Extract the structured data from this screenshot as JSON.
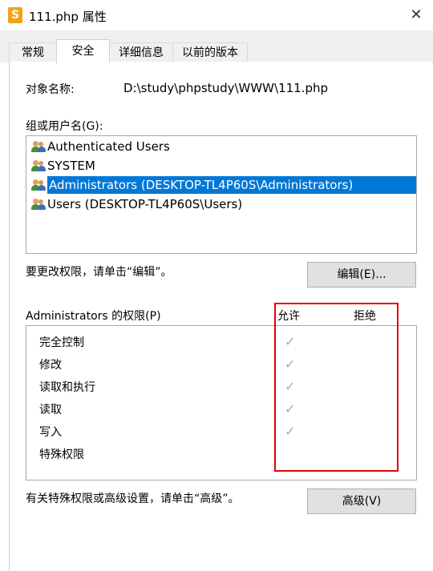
{
  "window": {
    "title": "111.php 属性",
    "app_icon": "sublime-text-icon",
    "close_label": "✕"
  },
  "tabs": [
    {
      "label": "常规",
      "active": false
    },
    {
      "label": "安全",
      "active": true
    },
    {
      "label": "详细信息",
      "active": false
    },
    {
      "label": "以前的版本",
      "active": false
    }
  ],
  "object": {
    "label": "对象名称:",
    "value": "D:\\study\\phpstudy\\WWW\\111.php"
  },
  "groups": {
    "label": "组或用户名(G):",
    "items": [
      {
        "label": "Authenticated Users",
        "selected": false
      },
      {
        "label": "SYSTEM",
        "selected": false
      },
      {
        "label": "Administrators (DESKTOP-TL4P60S\\Administrators)",
        "selected": true
      },
      {
        "label": "Users (DESKTOP-TL4P60S\\Users)",
        "selected": false
      }
    ]
  },
  "edit": {
    "hint": "要更改权限，请单击“编辑”。",
    "button_label": "编辑(E)..."
  },
  "permissions": {
    "label": "Administrators 的权限(P)",
    "allow_header": "允许",
    "deny_header": "拒绝",
    "check_glyph": "✓",
    "rows": [
      {
        "name": "完全控制",
        "allow": true,
        "deny": false
      },
      {
        "name": "修改",
        "allow": true,
        "deny": false
      },
      {
        "name": "读取和执行",
        "allow": true,
        "deny": false
      },
      {
        "name": "读取",
        "allow": true,
        "deny": false
      },
      {
        "name": "写入",
        "allow": true,
        "deny": false
      },
      {
        "name": "特殊权限",
        "allow": false,
        "deny": false
      }
    ]
  },
  "advanced": {
    "hint": "有关特殊权限或高级设置，请单击“高级”。",
    "button_label": "高级(V)"
  },
  "colors": {
    "selection": "#0078d7",
    "highlight_box": "#e60000",
    "check": "#a8a8a8"
  }
}
